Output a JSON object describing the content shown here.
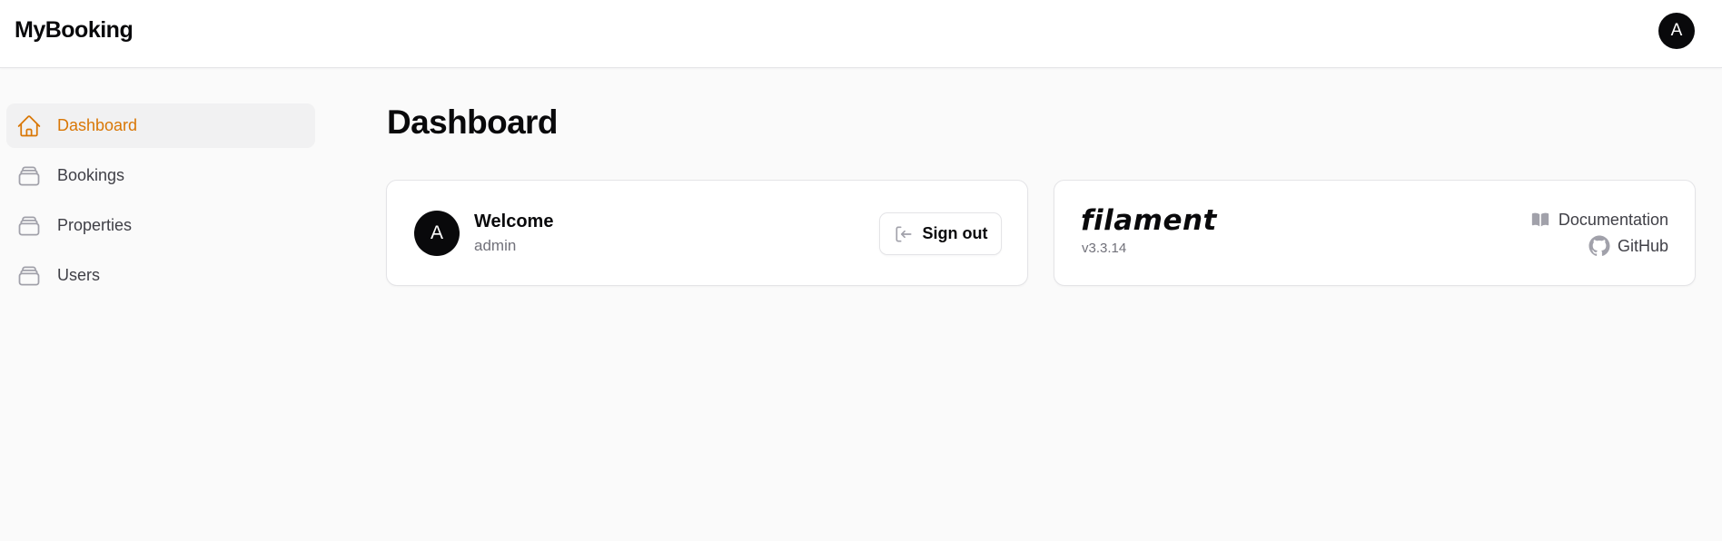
{
  "app": {
    "brand": "MyBooking",
    "user_initial": "A"
  },
  "colors": {
    "accent": "#d97706",
    "text": "#09090b",
    "muted": "#71717a",
    "border": "#e4e4e7",
    "bg": "#fafafa"
  },
  "sidebar": {
    "items": [
      {
        "label": "Dashboard",
        "icon": "home-icon",
        "active": true
      },
      {
        "label": "Bookings",
        "icon": "stack-icon",
        "active": false
      },
      {
        "label": "Properties",
        "icon": "stack-icon",
        "active": false
      },
      {
        "label": "Users",
        "icon": "stack-icon",
        "active": false
      }
    ]
  },
  "main": {
    "title": "Dashboard",
    "welcome_card": {
      "avatar_initial": "A",
      "title": "Welcome",
      "username": "admin",
      "signout_label": "Sign out"
    },
    "filament_card": {
      "logo_text": "filament",
      "version": "v3.3.14",
      "docs_label": "Documentation",
      "github_label": "GitHub"
    }
  }
}
